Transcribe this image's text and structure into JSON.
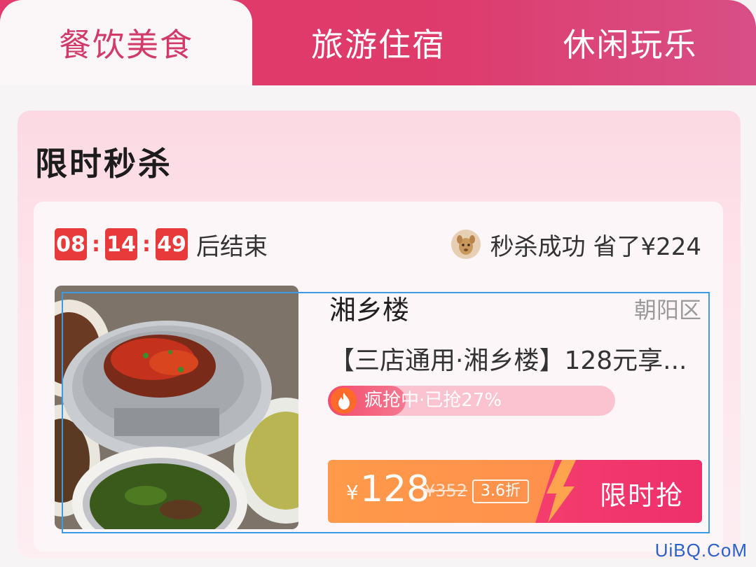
{
  "tabs": [
    {
      "label": "餐饮美食",
      "active": true
    },
    {
      "label": "旅游住宿",
      "active": false
    },
    {
      "label": "休闲玩乐",
      "active": false
    }
  ],
  "section": {
    "title": "限时秒杀"
  },
  "countdown": {
    "hours": "08",
    "minutes": "14",
    "seconds": "49",
    "separator": ":",
    "suffix": "后结束"
  },
  "success_note": {
    "text": "秒杀成功 省了¥224"
  },
  "product": {
    "shop_name": "湘乡楼",
    "district": "朝阳区",
    "title": "【三店通用·湘乡楼】128元享...",
    "progress_text": "疯抢中·已抢27%",
    "progress_fraction": 0.27,
    "price_symbol": "¥",
    "price_now": "128",
    "price_original": "¥352",
    "discount": "3.6折",
    "buy_label": "限时抢"
  },
  "watermark": "UiBQ.CoM",
  "colors": {
    "accent": "#e23a6c",
    "countdown": "#e83a3a",
    "price_bar": "#ff9a4a",
    "buy_button": "#f43d6e"
  }
}
